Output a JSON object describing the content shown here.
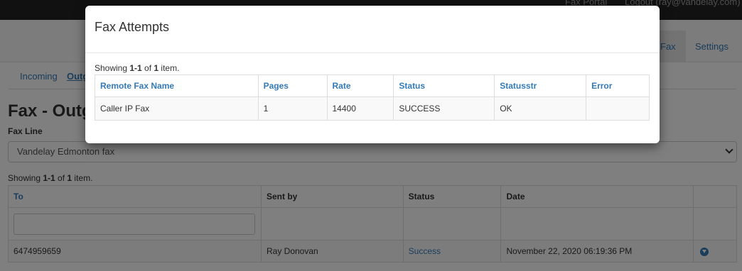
{
  "topbar": {
    "portal_link": "Fax Portal",
    "logout_link": "Logout (ray@vandelay.com)"
  },
  "nav": {
    "fax_tab": "Fax",
    "settings_tab": "Settings"
  },
  "subnav": {
    "incoming": "Incoming",
    "outgoing": "Outgoing"
  },
  "page": {
    "title": "Fax - Outgoing",
    "fax_line_label": "Fax Line",
    "fax_line_value": "Vandelay Edmonton fax",
    "summary": {
      "prefix": "Showing ",
      "range": "1-1",
      "mid": " of ",
      "total": "1",
      "suffix": " item."
    }
  },
  "table": {
    "headers": {
      "to": "To",
      "sent_by": "Sent by",
      "status": "Status",
      "date": "Date"
    },
    "filter_placeholder": "",
    "rows": [
      {
        "to": "6474959659",
        "sent_by": "Ray Donovan",
        "status": "Success",
        "date": "November 22, 2020 06:19:36 PM",
        "action_icon": "download-icon"
      }
    ]
  },
  "modal": {
    "title": "Fax Attempts",
    "summary": {
      "prefix": "Showing ",
      "range": "1-1",
      "mid": " of ",
      "total": "1",
      "suffix": " item."
    },
    "headers": [
      "Remote Fax Name",
      "Pages",
      "Rate",
      "Status",
      "Statusstr",
      "Error"
    ],
    "rows": [
      {
        "remote_fax_name": "Caller IP Fax",
        "pages": "1",
        "rate": "14400",
        "status": "SUCCESS",
        "statusstr": "OK",
        "error": ""
      }
    ]
  },
  "colors": {
    "link": "#337ab7",
    "navbar": "#222222",
    "backdrop": "rgba(0,0,0,0.5)"
  }
}
